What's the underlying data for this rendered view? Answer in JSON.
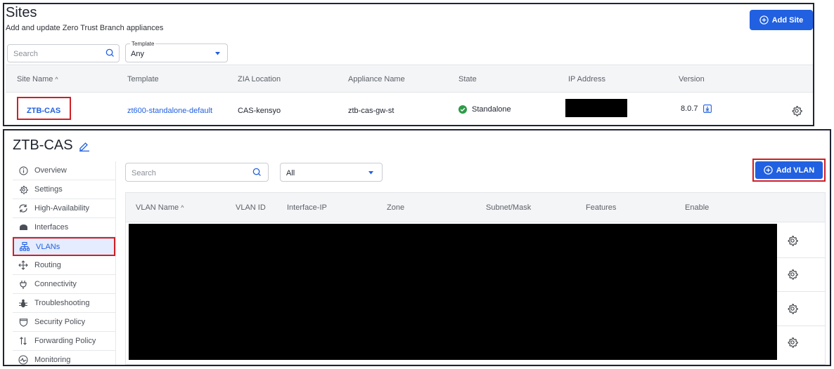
{
  "sites": {
    "title": "Sites",
    "subtitle": "Add and update Zero Trust Branch appliances",
    "add_button": "Add Site",
    "search_placeholder": "Search",
    "template_legend": "Template",
    "template_value": "Any",
    "columns": [
      "Site Name",
      "Template",
      "ZIA Location",
      "Appliance Name",
      "State",
      "IP Address",
      "Version"
    ],
    "rows": [
      {
        "site_name": "ZTB-CAS",
        "template": "zt600-standalone-default",
        "zia_location": "CAS-kensyo",
        "appliance_name": "ztb-cas-gw-st",
        "state": "Standalone",
        "version": "8.0.7"
      }
    ]
  },
  "detail": {
    "title": "ZTB-CAS",
    "nav": [
      {
        "label": "Overview",
        "icon": "info-icon"
      },
      {
        "label": "Settings",
        "icon": "gear-icon"
      },
      {
        "label": "High-Availability",
        "icon": "sync-icon"
      },
      {
        "label": "Interfaces",
        "icon": "interface-icon"
      },
      {
        "label": "VLANs",
        "icon": "network-icon"
      },
      {
        "label": "Routing",
        "icon": "move-icon"
      },
      {
        "label": "Connectivity",
        "icon": "plug-icon"
      },
      {
        "label": "Troubleshooting",
        "icon": "bug-icon"
      },
      {
        "label": "Security Policy",
        "icon": "shield-icon"
      },
      {
        "label": "Forwarding Policy",
        "icon": "arrows-icon"
      },
      {
        "label": "Monitoring",
        "icon": "monitor-icon"
      }
    ],
    "active_nav": "VLANs",
    "search_placeholder": "Search",
    "filter_value": "All",
    "add_button": "Add VLAN",
    "columns": [
      "VLAN Name",
      "VLAN ID",
      "Interface-IP",
      "Zone",
      "Subnet/Mask",
      "Features",
      "Enable"
    ],
    "sort_indicator": "^"
  },
  "colors": {
    "accent": "#2160e1",
    "highlight_border": "#d01f25",
    "success": "#2e9b47"
  }
}
